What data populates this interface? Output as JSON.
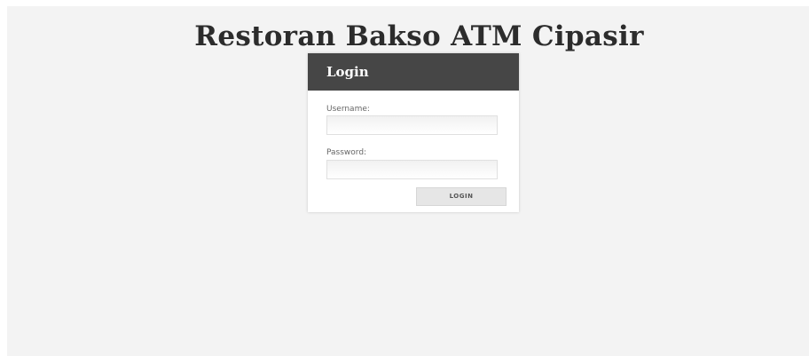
{
  "header": {
    "title": "Restoran Bakso ATM Cipasir"
  },
  "login_form": {
    "heading": "Login",
    "username_label": "Username:",
    "username_value": "",
    "password_label": "Password:",
    "password_value": "",
    "submit_label": "LOGIN"
  },
  "colors": {
    "page_background": "#f3f3f3",
    "panel_header": "#464646",
    "button_background": "#e6e6e6"
  }
}
